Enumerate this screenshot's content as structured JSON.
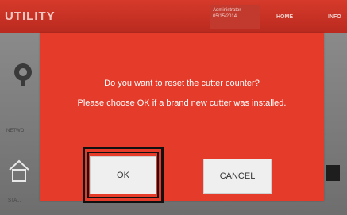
{
  "app": {
    "title": "UTILITY",
    "user_role": "Administrator",
    "date": "05/15/2014",
    "nav_home": "HOME",
    "nav_info": "INFO"
  },
  "tiles": {
    "network_label": "NETWO",
    "home_label": "STA..."
  },
  "dialog": {
    "line1": "Do you want to reset the cutter counter?",
    "line2": "Please choose OK if a brand new cutter was installed.",
    "ok_label": "OK",
    "cancel_label": "CANCEL"
  },
  "colors": {
    "dialog_bg": "#e43b2a",
    "topbar": "#c73124",
    "button_bg": "#efefef"
  }
}
